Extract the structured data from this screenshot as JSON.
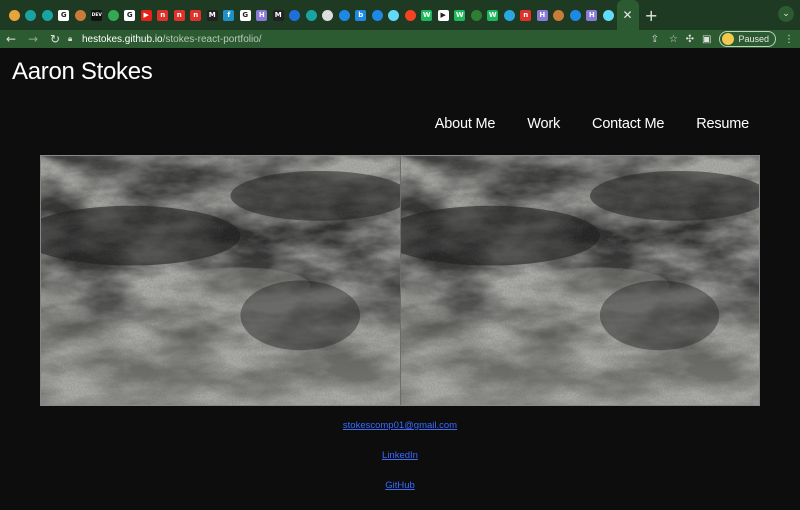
{
  "browser": {
    "url_host": "hestokes.github.io",
    "url_path": "/stokes-react-portfolio/",
    "profile_status": "Paused",
    "tabs": [
      {
        "icon": "orange-circle-icon",
        "color": "#e8a33c",
        "glyph": ""
      },
      {
        "icon": "teal-leaf-icon",
        "color": "#1aa3a3",
        "glyph": ""
      },
      {
        "icon": "teal-leaf-icon",
        "color": "#1aa3a3",
        "glyph": ""
      },
      {
        "icon": "google-icon",
        "color": "#ffffff",
        "glyph": "G"
      },
      {
        "icon": "hand-icon",
        "color": "#c97b3a",
        "glyph": ""
      },
      {
        "icon": "dev-icon",
        "color": "#111111",
        "glyph": "DEV"
      },
      {
        "icon": "drive-icon",
        "color": "#34a853",
        "glyph": ""
      },
      {
        "icon": "google-icon",
        "color": "#ffffff",
        "glyph": "G"
      },
      {
        "icon": "youtube-icon",
        "color": "#e62117",
        "glyph": "▶"
      },
      {
        "icon": "n-icon",
        "color": "#e0322b",
        "glyph": "n"
      },
      {
        "icon": "n-icon",
        "color": "#e0322b",
        "glyph": "n"
      },
      {
        "icon": "n-icon",
        "color": "#e0322b",
        "glyph": "n"
      },
      {
        "icon": "medium-icon",
        "color": "#222222",
        "glyph": "M"
      },
      {
        "icon": "feather-icon",
        "color": "#1e90c9",
        "glyph": "f"
      },
      {
        "icon": "google-icon",
        "color": "#ffffff",
        "glyph": "G"
      },
      {
        "icon": "h-icon",
        "color": "#8a7bd8",
        "glyph": "H"
      },
      {
        "icon": "medium-icon",
        "color": "#222222",
        "glyph": "M"
      },
      {
        "icon": "blue-dot-icon",
        "color": "#1e6fd9",
        "glyph": ""
      },
      {
        "icon": "teal-leaf-icon",
        "color": "#1aa3a3",
        "glyph": ""
      },
      {
        "icon": "github-icon",
        "color": "#dddddd",
        "glyph": ""
      },
      {
        "icon": "search-icon",
        "color": "#1e88e5",
        "glyph": ""
      },
      {
        "icon": "bing-icon",
        "color": "#1e88e5",
        "glyph": "b"
      },
      {
        "icon": "search-icon",
        "color": "#1e88e5",
        "glyph": ""
      },
      {
        "icon": "react-icon",
        "color": "#61dafb",
        "glyph": ""
      },
      {
        "icon": "joomla-icon",
        "color": "#f44321",
        "glyph": ""
      },
      {
        "icon": "w-icon",
        "color": "#1eb85c",
        "glyph": "W"
      },
      {
        "icon": "play-icon",
        "color": "#ffffff",
        "glyph": "▶"
      },
      {
        "icon": "w-icon",
        "color": "#1eb85c",
        "glyph": "W"
      },
      {
        "icon": "square-icon",
        "color": "#2e7d32",
        "glyph": ""
      },
      {
        "icon": "w-icon",
        "color": "#1eb85c",
        "glyph": "W"
      },
      {
        "icon": "edge-icon",
        "color": "#2aa7e0",
        "glyph": ""
      },
      {
        "icon": "n-icon",
        "color": "#e0322b",
        "glyph": "n"
      },
      {
        "icon": "h-icon",
        "color": "#8a7bd8",
        "glyph": "H"
      },
      {
        "icon": "hand-icon",
        "color": "#c97b3a",
        "glyph": ""
      },
      {
        "icon": "search-icon",
        "color": "#1e88e5",
        "glyph": ""
      },
      {
        "icon": "h-icon",
        "color": "#8a7bd8",
        "glyph": "H"
      },
      {
        "icon": "react-icon",
        "color": "#61dafb",
        "glyph": ""
      }
    ]
  },
  "site": {
    "title": "Aaron Stokes",
    "nav": [
      "About Me",
      "Work",
      "Contact Me",
      "Resume"
    ],
    "links": {
      "email": "stokescomp01@gmail.com",
      "linkedin": "LinkedIn",
      "github": "GitHub"
    },
    "colors": {
      "background": "#0d0d0d",
      "link": "#3b6bff",
      "text": "#ffffff"
    }
  }
}
